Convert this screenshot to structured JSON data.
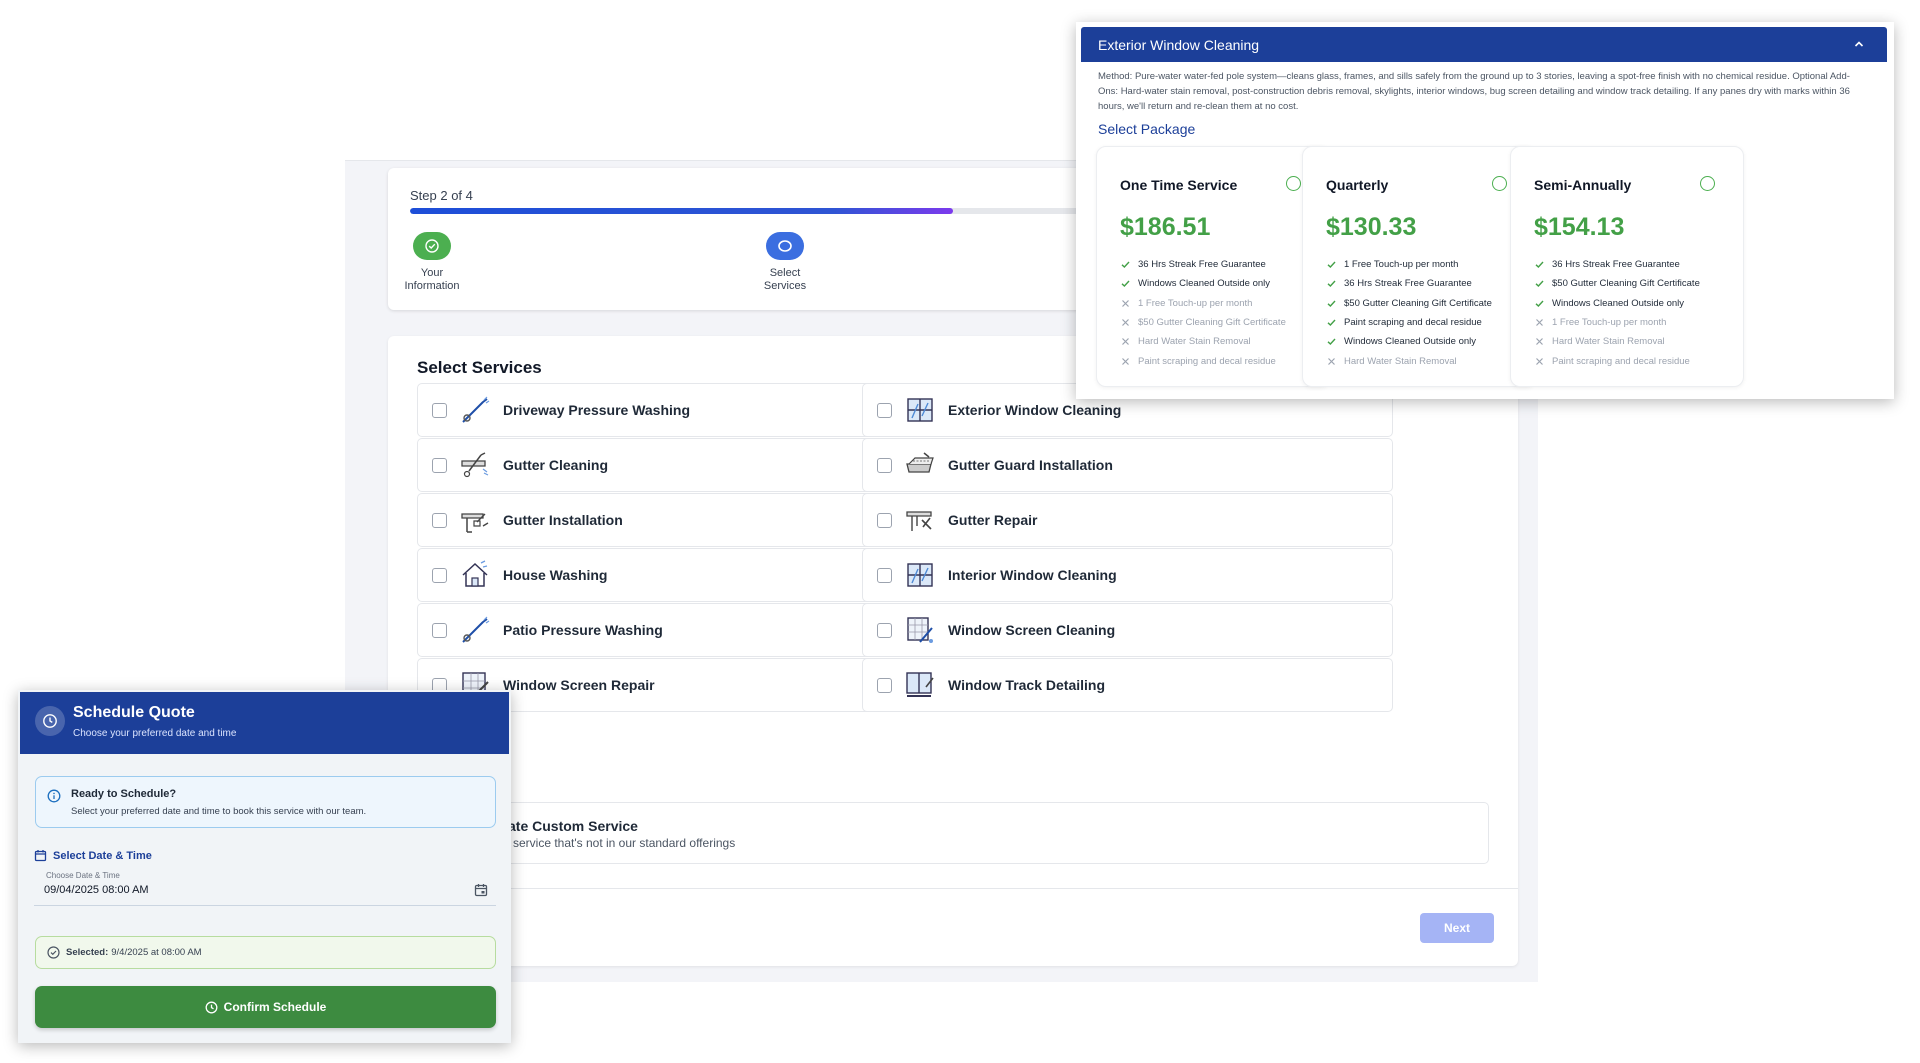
{
  "stepper": {
    "step_label": "Step 2 of 4",
    "progress": 0.5,
    "steps": [
      {
        "label_line1": "Your",
        "label_line2": "Information",
        "status": "completed"
      },
      {
        "label_line1": "Select",
        "label_line2": "Services",
        "status": "current"
      }
    ]
  },
  "services": {
    "title": "Select Services",
    "items": [
      {
        "label": "Driveway Pressure Washing",
        "icon": "pressure-washer-icon",
        "checked": false
      },
      {
        "label": "Exterior Window Cleaning",
        "icon": "window-icon",
        "checked": false
      },
      {
        "label": "Gutter Cleaning",
        "icon": "gutter-cleaning-icon",
        "checked": false
      },
      {
        "label": "Gutter Guard Installation",
        "icon": "gutter-guard-icon",
        "checked": false
      },
      {
        "label": "Gutter Installation",
        "icon": "gutter-install-icon",
        "checked": false
      },
      {
        "label": "Gutter Repair",
        "icon": "gutter-repair-icon",
        "checked": false
      },
      {
        "label": "House Washing",
        "icon": "house-wash-icon",
        "checked": false
      },
      {
        "label": "Interior Window Cleaning",
        "icon": "window-icon",
        "checked": false
      },
      {
        "label": "Patio Pressure Washing",
        "icon": "pressure-washer-icon",
        "checked": false
      },
      {
        "label": "Window Screen Cleaning",
        "icon": "screen-cleaning-icon",
        "checked": false
      },
      {
        "label": "Window Screen Repair",
        "icon": "screen-repair-icon",
        "checked": false
      },
      {
        "label": "Window Track Detailing",
        "icon": "window-track-icon",
        "checked": false
      }
    ],
    "custom": {
      "title": "ate Custom Service",
      "subtitle": "a service that's not in our standard offerings"
    },
    "next_label": "Next"
  },
  "exterior_popup": {
    "title": "Exterior Window Cleaning",
    "description": "Method: Pure-water water-fed pole system—cleans glass, frames, and sills safely from the ground up to 3 stories, leaving a spot-free finish with no chemical residue. Optional Add-Ons: Hard-water stain removal, post-construction debris removal, skylights, interior windows, bug screen detailing and window track detailing. If any panes dry with marks within 36 hours, we'll return and re-clean them at no cost.",
    "select_package_label": "Select Package",
    "packages": [
      {
        "name": "One Time Service",
        "price": "$186.51",
        "features": [
          {
            "text": "36 Hrs Streak Free Guarantee",
            "included": true
          },
          {
            "text": "Windows Cleaned Outside only",
            "included": true
          },
          {
            "text": "1 Free Touch-up per month",
            "included": false
          },
          {
            "text": "$50 Gutter Cleaning Gift Certificate",
            "included": false
          },
          {
            "text": "Hard Water Stain Removal",
            "included": false
          },
          {
            "text": "Paint scraping and decal residue",
            "included": false
          }
        ]
      },
      {
        "name": "Quarterly",
        "price": "$130.33",
        "features": [
          {
            "text": "1 Free Touch-up per month",
            "included": true
          },
          {
            "text": "36 Hrs Streak Free Guarantee",
            "included": true
          },
          {
            "text": "$50 Gutter Cleaning Gift Certificate",
            "included": true
          },
          {
            "text": "Paint scraping and decal residue",
            "included": true
          },
          {
            "text": "Windows Cleaned Outside only",
            "included": true
          },
          {
            "text": "Hard Water Stain Removal",
            "included": false
          }
        ]
      },
      {
        "name": "Semi-Annually",
        "price": "$154.13",
        "features": [
          {
            "text": "36 Hrs Streak Free Guarantee",
            "included": true
          },
          {
            "text": "$50 Gutter Cleaning Gift Certificate",
            "included": true
          },
          {
            "text": "Windows Cleaned Outside only",
            "included": true
          },
          {
            "text": "1 Free Touch-up per month",
            "included": false
          },
          {
            "text": "Hard Water Stain Removal",
            "included": false
          },
          {
            "text": "Paint scraping and decal residue",
            "included": false
          }
        ]
      }
    ]
  },
  "schedule_popup": {
    "title": "Schedule Quote",
    "subtitle": "Choose your preferred date and time",
    "ready_title": "Ready to Schedule?",
    "ready_text": "Select your preferred date and time to book this service with our team.",
    "section_label": "Select Date & Time",
    "input_label": "Choose Date & Time",
    "input_value": "09/04/2025 08:00 AM",
    "selected_label": "Selected:",
    "selected_value": "9/4/2025 at 08:00 AM",
    "confirm_label": "Confirm Schedule"
  },
  "colors": {
    "brand_blue": "#1c3f99",
    "price_green": "#43a047",
    "confirm_green": "#3d8b40",
    "next_disabled": "#a5b4f5"
  }
}
